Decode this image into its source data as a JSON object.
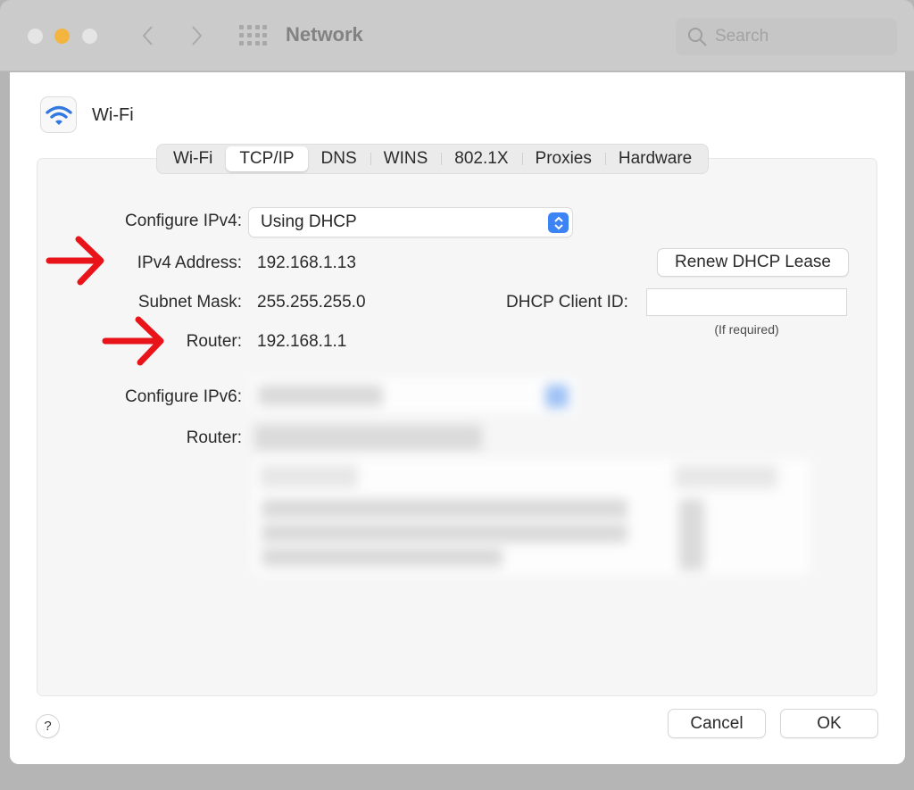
{
  "window": {
    "title": "Network",
    "search_placeholder": "Search",
    "traffic_lights": [
      "close",
      "minimize",
      "zoom"
    ],
    "colors": {
      "minimize": "#f3b53f",
      "accent": "#3c83f6",
      "annotation": "#e8141a"
    }
  },
  "service": {
    "name": "Wi-Fi",
    "icon": "wifi-icon"
  },
  "tabs": [
    {
      "label": "Wi-Fi",
      "active": false
    },
    {
      "label": "TCP/IP",
      "active": true
    },
    {
      "label": "DNS",
      "active": false
    },
    {
      "label": "WINS",
      "active": false
    },
    {
      "label": "802.1X",
      "active": false
    },
    {
      "label": "Proxies",
      "active": false
    },
    {
      "label": "Hardware",
      "active": false
    }
  ],
  "ipv4": {
    "configure_label": "Configure IPv4:",
    "configure_value": "Using DHCP",
    "address_label": "IPv4 Address:",
    "address_value": "192.168.1.13",
    "subnet_label": "Subnet Mask:",
    "subnet_value": "255.255.255.0",
    "router_label": "Router:",
    "router_value": "192.168.1.1"
  },
  "dhcp": {
    "renew_button": "Renew DHCP Lease",
    "client_id_label": "DHCP Client ID:",
    "client_id_value": "",
    "client_id_hint": "(If required)"
  },
  "ipv6": {
    "configure_label": "Configure IPv6:",
    "router_label": "Router:",
    "redacted": true
  },
  "footer": {
    "help": "?",
    "cancel": "Cancel",
    "ok": "OK"
  }
}
